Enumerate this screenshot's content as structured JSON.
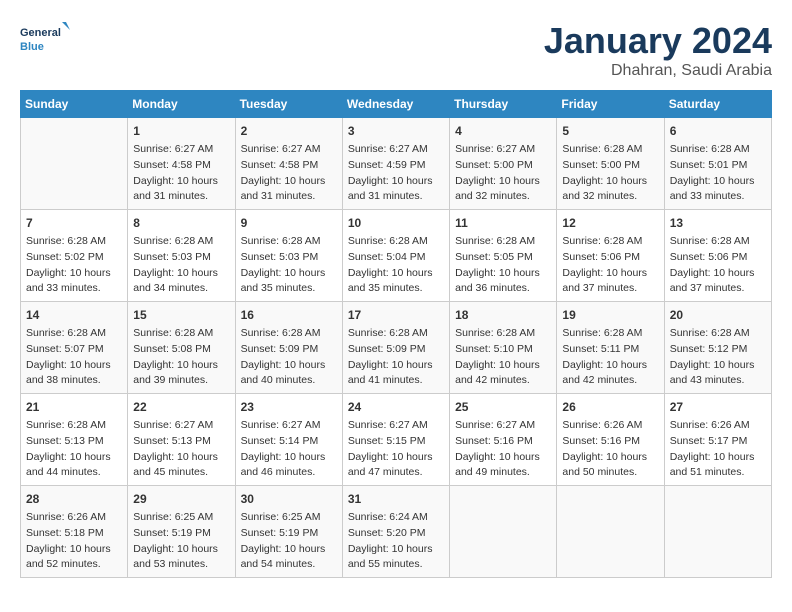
{
  "header": {
    "logo_general": "General",
    "logo_blue": "Blue",
    "month": "January 2024",
    "location": "Dhahran, Saudi Arabia"
  },
  "days_of_week": [
    "Sunday",
    "Monday",
    "Tuesday",
    "Wednesday",
    "Thursday",
    "Friday",
    "Saturday"
  ],
  "weeks": [
    [
      {
        "day": "",
        "content": ""
      },
      {
        "day": "1",
        "content": "Sunrise: 6:27 AM\nSunset: 4:58 PM\nDaylight: 10 hours\nand 31 minutes."
      },
      {
        "day": "2",
        "content": "Sunrise: 6:27 AM\nSunset: 4:58 PM\nDaylight: 10 hours\nand 31 minutes."
      },
      {
        "day": "3",
        "content": "Sunrise: 6:27 AM\nSunset: 4:59 PM\nDaylight: 10 hours\nand 31 minutes."
      },
      {
        "day": "4",
        "content": "Sunrise: 6:27 AM\nSunset: 5:00 PM\nDaylight: 10 hours\nand 32 minutes."
      },
      {
        "day": "5",
        "content": "Sunrise: 6:28 AM\nSunset: 5:00 PM\nDaylight: 10 hours\nand 32 minutes."
      },
      {
        "day": "6",
        "content": "Sunrise: 6:28 AM\nSunset: 5:01 PM\nDaylight: 10 hours\nand 33 minutes."
      }
    ],
    [
      {
        "day": "7",
        "content": "Sunrise: 6:28 AM\nSunset: 5:02 PM\nDaylight: 10 hours\nand 33 minutes."
      },
      {
        "day": "8",
        "content": "Sunrise: 6:28 AM\nSunset: 5:03 PM\nDaylight: 10 hours\nand 34 minutes."
      },
      {
        "day": "9",
        "content": "Sunrise: 6:28 AM\nSunset: 5:03 PM\nDaylight: 10 hours\nand 35 minutes."
      },
      {
        "day": "10",
        "content": "Sunrise: 6:28 AM\nSunset: 5:04 PM\nDaylight: 10 hours\nand 35 minutes."
      },
      {
        "day": "11",
        "content": "Sunrise: 6:28 AM\nSunset: 5:05 PM\nDaylight: 10 hours\nand 36 minutes."
      },
      {
        "day": "12",
        "content": "Sunrise: 6:28 AM\nSunset: 5:06 PM\nDaylight: 10 hours\nand 37 minutes."
      },
      {
        "day": "13",
        "content": "Sunrise: 6:28 AM\nSunset: 5:06 PM\nDaylight: 10 hours\nand 37 minutes."
      }
    ],
    [
      {
        "day": "14",
        "content": "Sunrise: 6:28 AM\nSunset: 5:07 PM\nDaylight: 10 hours\nand 38 minutes."
      },
      {
        "day": "15",
        "content": "Sunrise: 6:28 AM\nSunset: 5:08 PM\nDaylight: 10 hours\nand 39 minutes."
      },
      {
        "day": "16",
        "content": "Sunrise: 6:28 AM\nSunset: 5:09 PM\nDaylight: 10 hours\nand 40 minutes."
      },
      {
        "day": "17",
        "content": "Sunrise: 6:28 AM\nSunset: 5:09 PM\nDaylight: 10 hours\nand 41 minutes."
      },
      {
        "day": "18",
        "content": "Sunrise: 6:28 AM\nSunset: 5:10 PM\nDaylight: 10 hours\nand 42 minutes."
      },
      {
        "day": "19",
        "content": "Sunrise: 6:28 AM\nSunset: 5:11 PM\nDaylight: 10 hours\nand 42 minutes."
      },
      {
        "day": "20",
        "content": "Sunrise: 6:28 AM\nSunset: 5:12 PM\nDaylight: 10 hours\nand 43 minutes."
      }
    ],
    [
      {
        "day": "21",
        "content": "Sunrise: 6:28 AM\nSunset: 5:13 PM\nDaylight: 10 hours\nand 44 minutes."
      },
      {
        "day": "22",
        "content": "Sunrise: 6:27 AM\nSunset: 5:13 PM\nDaylight: 10 hours\nand 45 minutes."
      },
      {
        "day": "23",
        "content": "Sunrise: 6:27 AM\nSunset: 5:14 PM\nDaylight: 10 hours\nand 46 minutes."
      },
      {
        "day": "24",
        "content": "Sunrise: 6:27 AM\nSunset: 5:15 PM\nDaylight: 10 hours\nand 47 minutes."
      },
      {
        "day": "25",
        "content": "Sunrise: 6:27 AM\nSunset: 5:16 PM\nDaylight: 10 hours\nand 49 minutes."
      },
      {
        "day": "26",
        "content": "Sunrise: 6:26 AM\nSunset: 5:16 PM\nDaylight: 10 hours\nand 50 minutes."
      },
      {
        "day": "27",
        "content": "Sunrise: 6:26 AM\nSunset: 5:17 PM\nDaylight: 10 hours\nand 51 minutes."
      }
    ],
    [
      {
        "day": "28",
        "content": "Sunrise: 6:26 AM\nSunset: 5:18 PM\nDaylight: 10 hours\nand 52 minutes."
      },
      {
        "day": "29",
        "content": "Sunrise: 6:25 AM\nSunset: 5:19 PM\nDaylight: 10 hours\nand 53 minutes."
      },
      {
        "day": "30",
        "content": "Sunrise: 6:25 AM\nSunset: 5:19 PM\nDaylight: 10 hours\nand 54 minutes."
      },
      {
        "day": "31",
        "content": "Sunrise: 6:24 AM\nSunset: 5:20 PM\nDaylight: 10 hours\nand 55 minutes."
      },
      {
        "day": "",
        "content": ""
      },
      {
        "day": "",
        "content": ""
      },
      {
        "day": "",
        "content": ""
      }
    ]
  ]
}
